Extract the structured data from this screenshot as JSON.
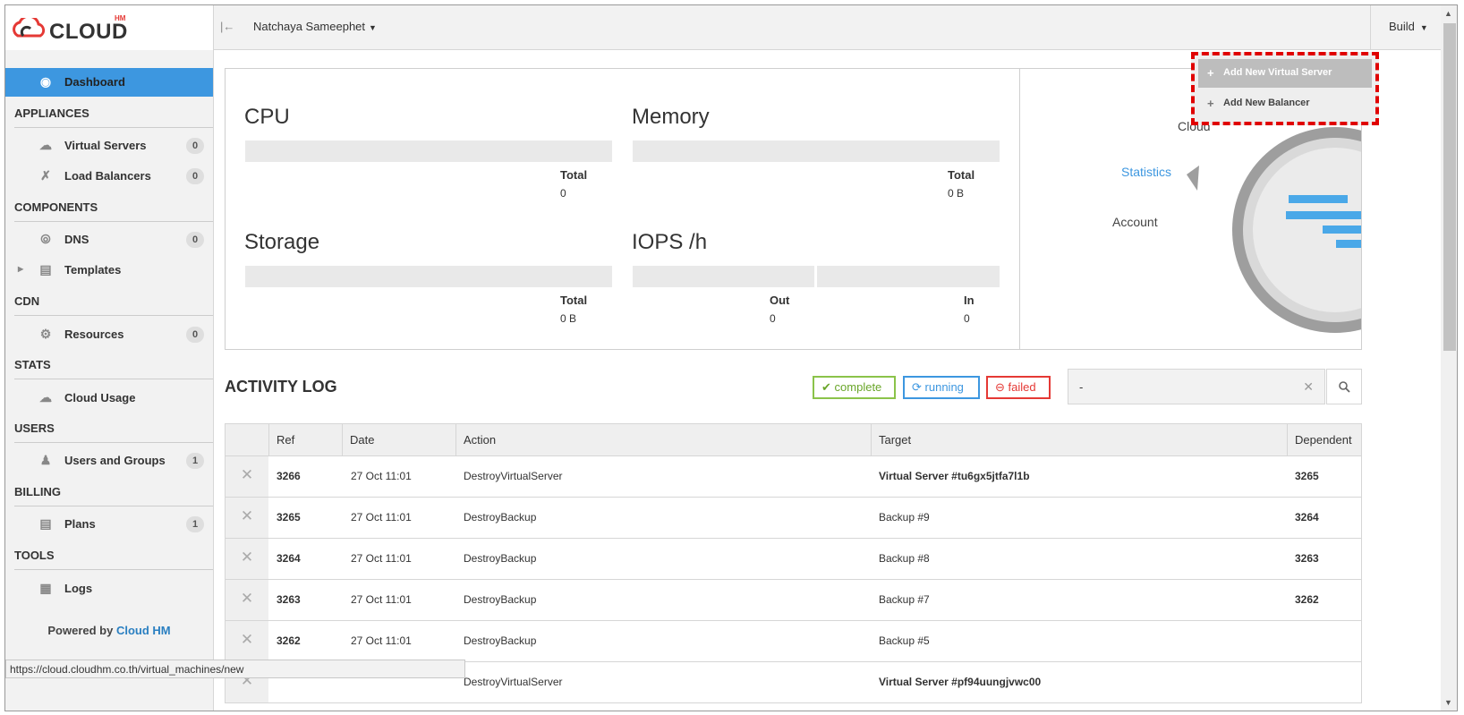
{
  "topbar": {
    "brand": "CLOUD",
    "brand_sup": "HM",
    "user_name": "Natchaya Sameephet",
    "build_label": "Build"
  },
  "sidebar": {
    "dashboard": "Dashboard",
    "sections": {
      "appliances": "APPLIANCES",
      "components": "COMPONENTS",
      "cdn": "CDN",
      "stats": "STATS",
      "users": "USERS",
      "billing": "BILLING",
      "tools": "TOOLS"
    },
    "items": {
      "virtual_servers": {
        "label": "Virtual Servers",
        "count": "0"
      },
      "load_balancers": {
        "label": "Load Balancers",
        "count": "0"
      },
      "dns": {
        "label": "DNS",
        "count": "0"
      },
      "templates": {
        "label": "Templates"
      },
      "resources": {
        "label": "Resources",
        "count": "0"
      },
      "cloud_usage": {
        "label": "Cloud Usage"
      },
      "users_groups": {
        "label": "Users and Groups",
        "count": "1"
      },
      "plans": {
        "label": "Plans",
        "count": "1"
      },
      "logs": {
        "label": "Logs"
      }
    },
    "powered_prefix": "Powered by",
    "powered_brand": "Cloud HM"
  },
  "stats": {
    "cpu": {
      "title": "CPU",
      "total_label": "Total",
      "total": "0"
    },
    "memory": {
      "title": "Memory",
      "total_label": "Total",
      "total": "0 B"
    },
    "storage": {
      "title": "Storage",
      "total_label": "Total",
      "total": "0 B"
    },
    "iops": {
      "title": "IOPS /h",
      "out_label": "Out",
      "out": "0",
      "in_label": "In",
      "in": "0"
    },
    "wheel": {
      "cloud": "Cloud",
      "statistics": "Statistics",
      "account": "Account"
    }
  },
  "build_dropdown": {
    "add_virtual_server": "Add New Virtual Server",
    "add_balancer": "Add New Balancer"
  },
  "activity_log": {
    "title": "ACTIVITY LOG",
    "filters": {
      "complete": "complete",
      "running": "running",
      "failed": "failed"
    },
    "search_value": "-",
    "columns": [
      "Ref",
      "Date",
      "Action",
      "Target",
      "Dependent"
    ],
    "rows": [
      {
        "ref": "3266",
        "date": "27 Oct 11:01",
        "action": "DestroyVirtualServer",
        "target": "Virtual Server #tu6gx5jtfa7l1b",
        "dependent": "3265"
      },
      {
        "ref": "3265",
        "date": "27 Oct 11:01",
        "action": "DestroyBackup",
        "target": "Backup #9",
        "dependent": "3264"
      },
      {
        "ref": "3264",
        "date": "27 Oct 11:01",
        "action": "DestroyBackup",
        "target": "Backup #8",
        "dependent": "3263"
      },
      {
        "ref": "3263",
        "date": "27 Oct 11:01",
        "action": "DestroyBackup",
        "target": "Backup #7",
        "dependent": "3262"
      },
      {
        "ref": "3262",
        "date": "27 Oct 11:01",
        "action": "DestroyBackup",
        "target": "Backup #5",
        "dependent": ""
      },
      {
        "ref": "",
        "date": "",
        "action": "DestroyVirtualServer",
        "target": "Virtual Server #pf94uungjvwc00",
        "dependent": ""
      }
    ]
  },
  "statusbar": {
    "url": "https://cloud.cloudhm.co.th/virtual_machines/new"
  },
  "colors": {
    "accent": "#3d97e0",
    "complete": "#8bc34a",
    "failed": "#e53935",
    "highlight_border": "#e00000"
  }
}
